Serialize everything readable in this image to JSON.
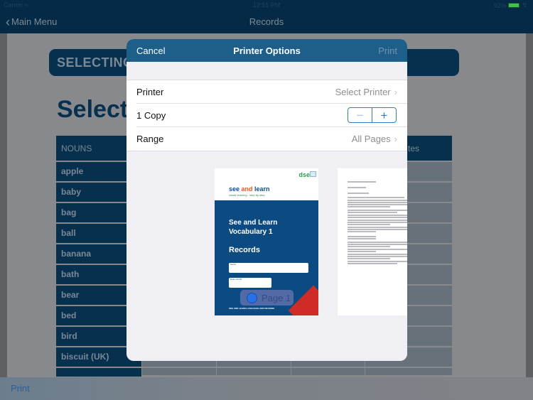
{
  "status_bar": {
    "carrier": "Carrier",
    "wifi_icon": "wifi-icon",
    "time": "12:51 PM",
    "battery": "92%",
    "battery_level": 0.92,
    "battery_color": "#3cc24d",
    "charging_icon": "bolt-icon"
  },
  "nav": {
    "back_label": "Main Menu",
    "back_icon": "chevron-left-icon",
    "title": "Records"
  },
  "document": {
    "banner": "SELECTING",
    "heading": "Selecti",
    "table": {
      "headers": [
        "NOUNS",
        "",
        "",
        "",
        "Notes"
      ],
      "header_visible_right": "tes",
      "rows": [
        "apple",
        "baby",
        "bag",
        "ball",
        "banana",
        "bath",
        "bear",
        "bed",
        "bird",
        "biscuit (UK)"
      ]
    }
  },
  "toolbar": {
    "print_label": "Print"
  },
  "modal": {
    "cancel_label": "Cancel",
    "title": "Printer Options",
    "print_label": "Print",
    "header_color": "#1d5f89",
    "rows": {
      "printer": {
        "label": "Printer",
        "value": "Select Printer"
      },
      "copies": {
        "label": "1 Copy",
        "count": 1,
        "minus": "−",
        "plus": "+"
      },
      "range": {
        "label": "Range",
        "value": "All Pages"
      }
    },
    "preview": {
      "page1": {
        "logo": "dse",
        "brand_see": "see ",
        "brand_and": "and",
        "brand_learn": " learn",
        "tagline": "visual learning - step by step",
        "title_line1": "See and Learn",
        "title_line2": "Vocabulary 1",
        "subtitle": "Records",
        "field_name": "Name",
        "field_dob": "Date of birth",
        "footer": "SEE AND LEARN LANGUAGE AND READING",
        "badge": "Page 1"
      }
    }
  }
}
